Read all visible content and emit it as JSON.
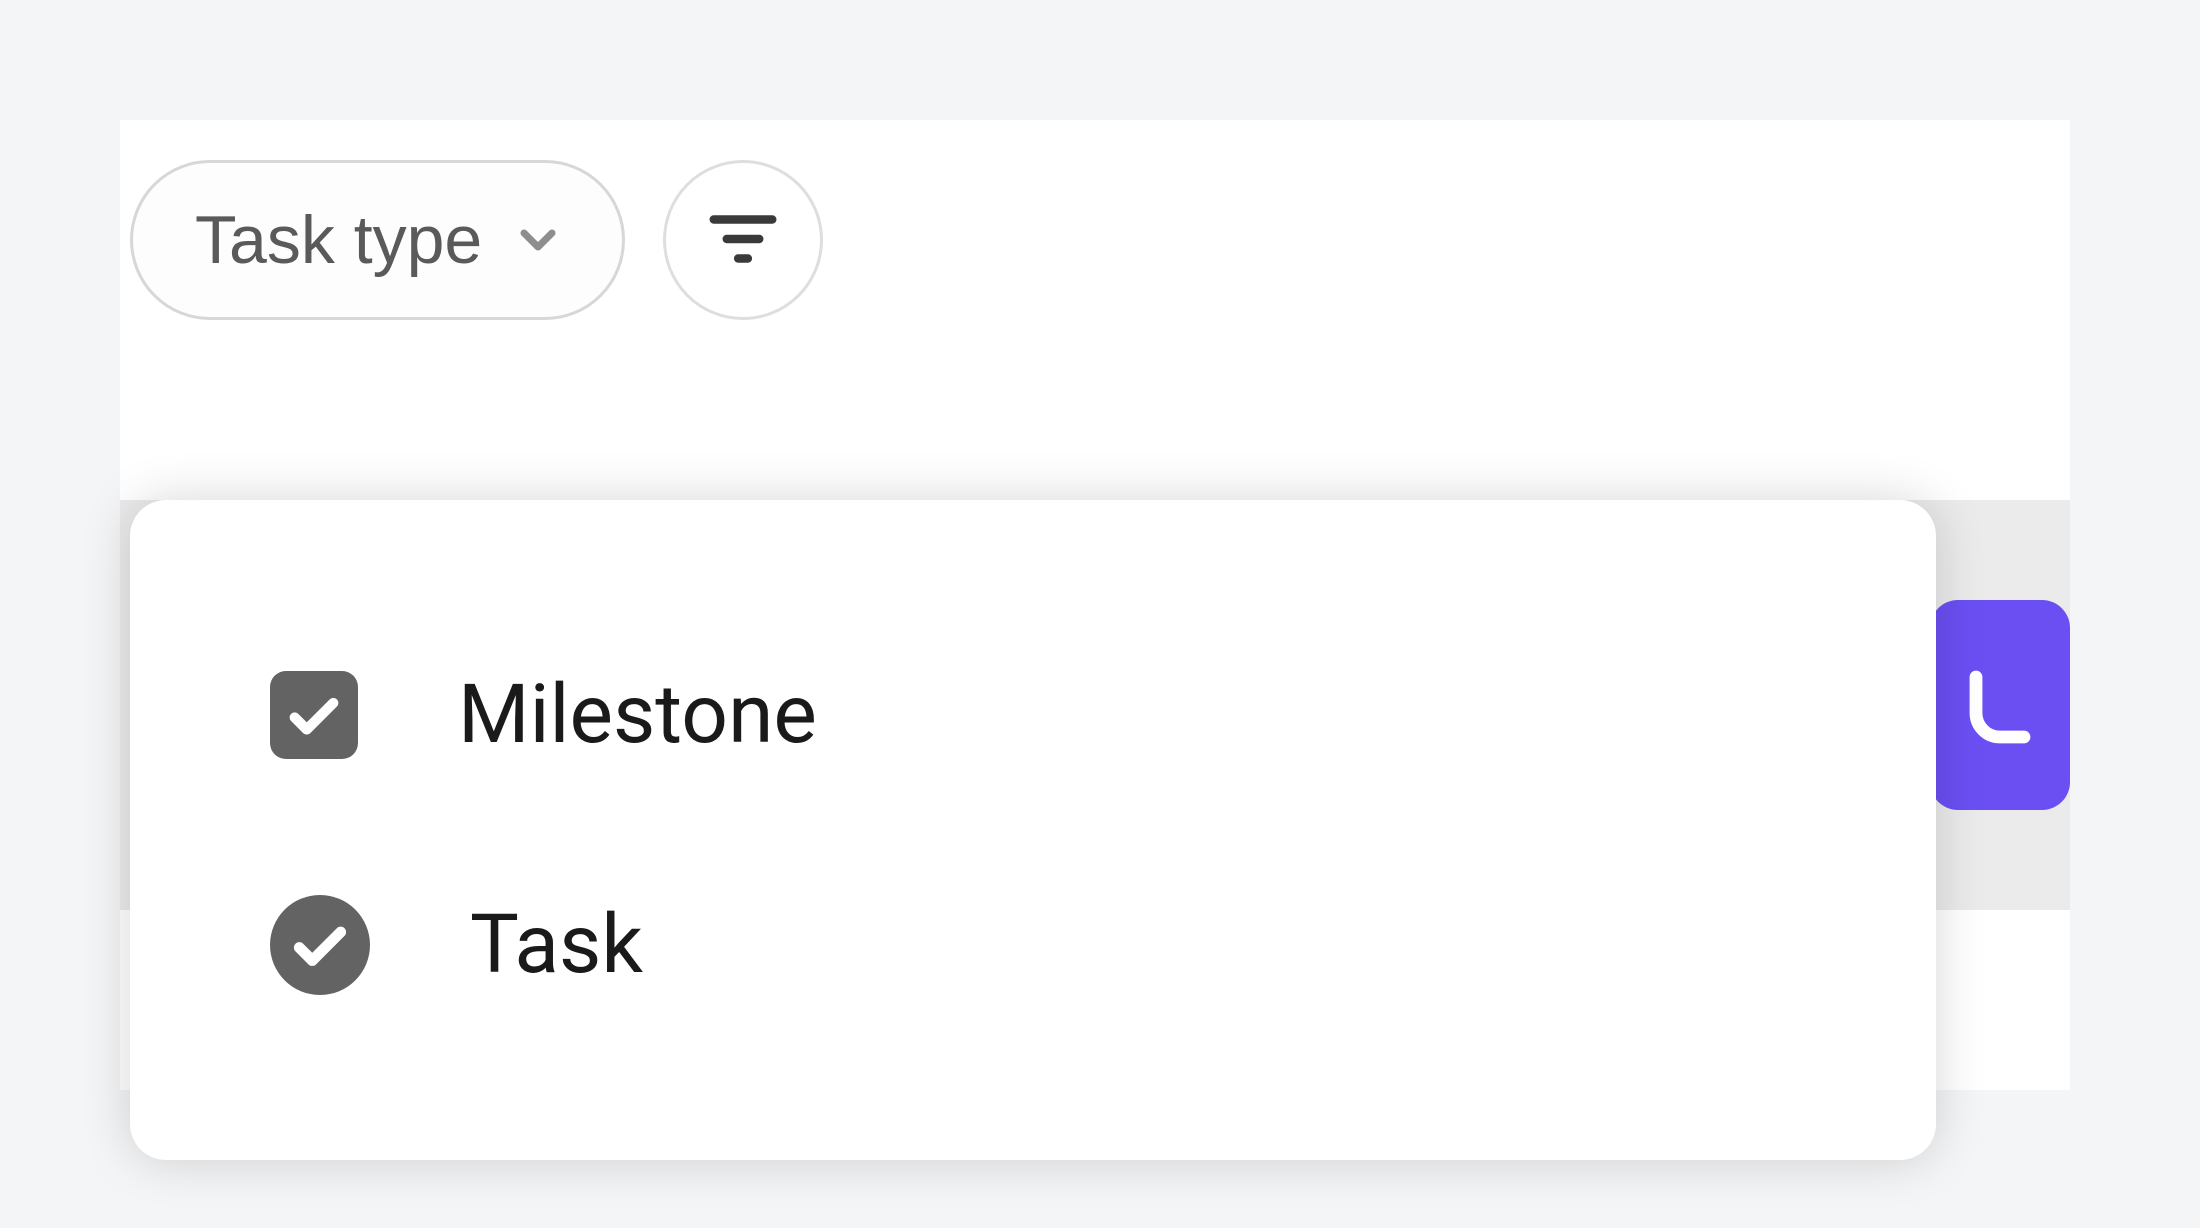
{
  "filter": {
    "task_type_label": "Task type"
  },
  "dropdown": {
    "items": [
      {
        "label": "Milestone",
        "shape": "milestone",
        "checked": true
      },
      {
        "label": "Task",
        "shape": "task",
        "checked": true
      }
    ]
  },
  "colors": {
    "accent": "#6b4ff3",
    "marker": "#636363"
  },
  "icons": {
    "chevron_down": "chevron-down-icon",
    "filter": "filter-icon"
  }
}
